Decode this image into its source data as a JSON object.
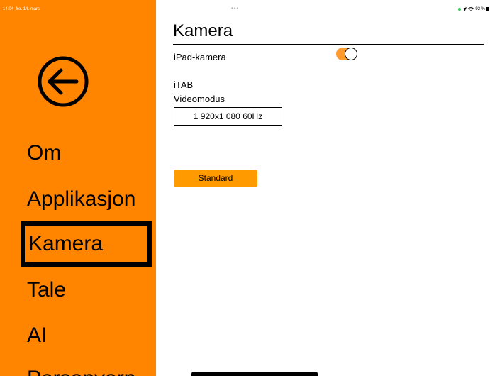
{
  "status_bar": {
    "time": "14:04",
    "date": "fre. 14. mars",
    "dots": "•••",
    "battery": "92 %"
  },
  "sidebar": {
    "items": [
      {
        "label": "Om"
      },
      {
        "label": "Applikasjon"
      },
      {
        "label": "Kamera"
      },
      {
        "label": "Tale"
      },
      {
        "label": "AI"
      },
      {
        "label": "Personvern"
      }
    ],
    "selected": "Kamera"
  },
  "main": {
    "title": "Kamera",
    "ipad_camera_label": "iPad-kamera",
    "ipad_camera_enabled": true,
    "device_label": "iTAB",
    "video_mode_label": "Videomodus",
    "video_mode_value": "1 920x1 080 60Hz",
    "default_button_label": "Standard"
  },
  "colors": {
    "sidebar_bg": "#ff8400",
    "accent": "#ff9a00",
    "toggle_on": "#ff9a2e"
  }
}
